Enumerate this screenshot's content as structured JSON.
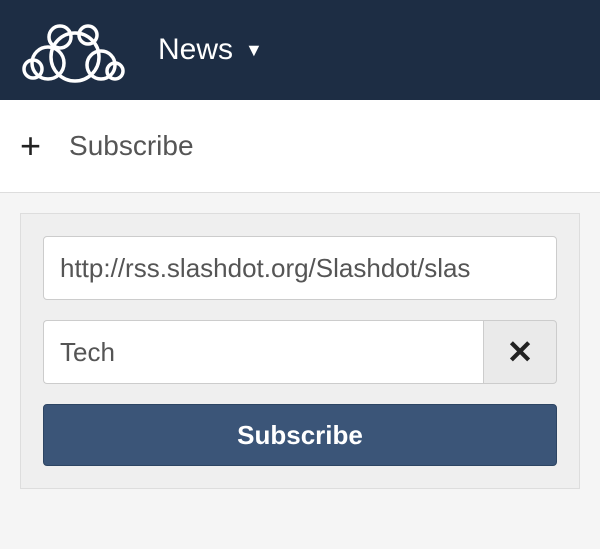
{
  "header": {
    "app_name": "News"
  },
  "subscribe_section": {
    "header_label": "Subscribe",
    "url_value": "http://rss.slashdot.org/Slashdot/slas",
    "name_value": "Tech",
    "submit_label": "Subscribe"
  },
  "colors": {
    "header_bg": "#1d2d44",
    "button_bg": "#3b5578"
  }
}
